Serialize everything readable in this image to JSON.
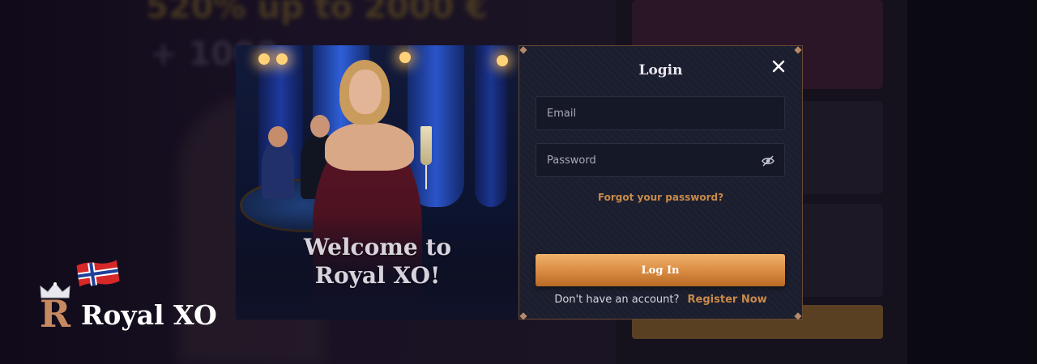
{
  "background": {
    "promo_line_1": "520% up to 2000 €",
    "promo_line_2": "+ 1000"
  },
  "welcome_panel": {
    "heading_line_1": "Welcome to",
    "heading_line_2": "Royal XO!"
  },
  "login": {
    "title": "Login",
    "close_icon": "close-icon",
    "email_placeholder": "Email",
    "password_placeholder": "Password",
    "password_toggle_icon": "eye-slash-icon",
    "forgot_password": "Forgot your password?",
    "login_button": "Log In",
    "no_account_text": "Don't have an account?",
    "register_link": "Register Now"
  },
  "brand": {
    "name": "Royal XO",
    "monogram": "R",
    "flag": "norway-flag"
  },
  "colors": {
    "accent": "#c98a4a",
    "button_top": "#f0b26b",
    "button_bottom": "#b86a26",
    "panel_bg": "#1b1e2e",
    "page_bg": "#0c0816"
  }
}
